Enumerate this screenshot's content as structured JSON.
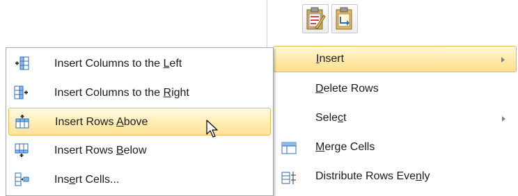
{
  "main_menu": {
    "paste_options": [
      {
        "icon": "paste-keep-formatting-icon"
      },
      {
        "icon": "paste-text-only-icon"
      }
    ],
    "items": [
      {
        "pre": "",
        "u": "I",
        "post": "nsert",
        "submenu": true,
        "highlighted": true
      },
      {
        "pre": "",
        "u": "D",
        "post": "elete Rows",
        "submenu": false
      },
      {
        "pre": "Sele",
        "u": "c",
        "post": "t",
        "submenu": true
      },
      {
        "pre": "",
        "u": "M",
        "post": "erge Cells",
        "submenu": false,
        "icon": "merge-cells-icon"
      },
      {
        "pre": "Distribute Rows Eve",
        "u": "n",
        "post": "ly",
        "submenu": false,
        "icon": "distribute-rows-icon"
      }
    ]
  },
  "insert_submenu": {
    "items": [
      {
        "pre": "Insert Columns to the ",
        "u": "L",
        "post": "eft",
        "icon": "insert-columns-left-icon"
      },
      {
        "pre": "Insert Columns to the ",
        "u": "R",
        "post": "ight",
        "icon": "insert-columns-right-icon"
      },
      {
        "pre": "Insert Rows ",
        "u": "A",
        "post": "bove",
        "icon": "insert-rows-above-icon",
        "highlighted": true
      },
      {
        "pre": "Insert Rows ",
        "u": "B",
        "post": "elow",
        "icon": "insert-rows-below-icon"
      },
      {
        "pre": "Ins",
        "u": "e",
        "post": "rt Cells...",
        "icon": "insert-cells-icon"
      }
    ]
  },
  "colors": {
    "highlight": "#ffe8a6",
    "highlight_border": "#e9b955",
    "icon_blue": "#2a6ebb"
  }
}
